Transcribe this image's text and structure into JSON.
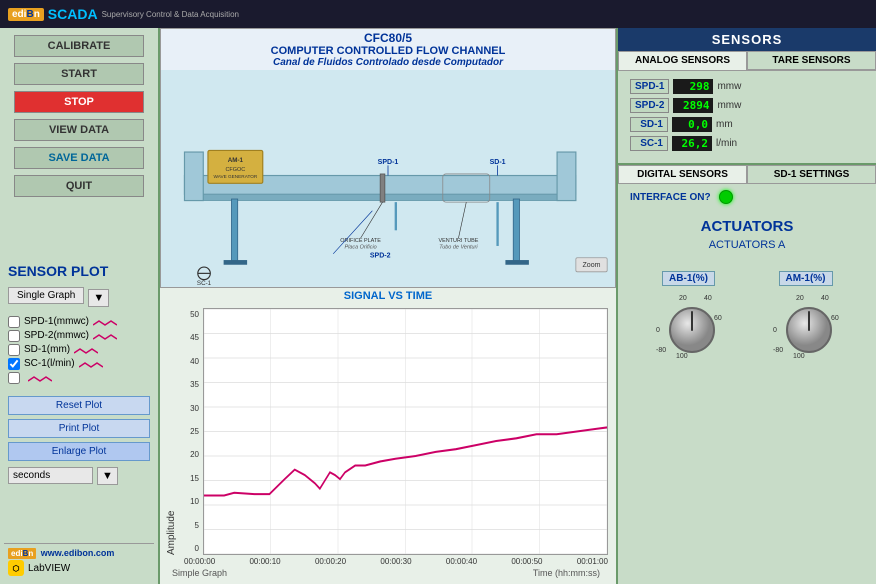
{
  "topbar": {
    "logo": "ediBon",
    "scada": "SCADA",
    "subtitle": "Supervisory Control & Data Acquisition"
  },
  "leftPanel": {
    "buttons": {
      "calibrate": "CALIBRATE",
      "start": "START",
      "stop": "STOP",
      "viewData": "VIEW DATA",
      "saveData": "SAVE DATA",
      "quit": "QUIT"
    },
    "sensorPlot": "SENSOR PLOT"
  },
  "graphControls": {
    "singleGraph": "Single Graph",
    "legend": [
      {
        "id": "spd1",
        "label": "SPD-1(mmwc)",
        "checked": false,
        "color": "#cc0066"
      },
      {
        "id": "spd2",
        "label": "SPD-2(mmwc)",
        "checked": false,
        "color": "#cc0066"
      },
      {
        "id": "sd1",
        "label": "SD-1(mm)",
        "checked": false,
        "color": "#cc0066"
      },
      {
        "id": "sc1",
        "label": "SC-1(l/min)",
        "checked": true,
        "color": "#cc0066"
      },
      {
        "id": "extra",
        "label": "",
        "checked": false,
        "color": "#cc0066"
      }
    ],
    "buttons": {
      "resetPlot": "Reset Plot",
      "printPlot": "Print Plot",
      "enlargePlot": "Enlarge Plot"
    },
    "seconds": "seconds"
  },
  "diagram": {
    "title1": "CFC80/5",
    "title2": "COMPUTER CONTROLLED FLOW CHANNEL",
    "title3": "Canal de Fluidos Controlado desde Computador"
  },
  "signalVsTime": "SIGNAL VS TIME",
  "chart": {
    "yAxisLabel": "Amplitude",
    "yTicks": [
      "50",
      "45",
      "40",
      "35",
      "30",
      "25",
      "20",
      "15",
      "10",
      "5",
      "0"
    ],
    "xLabels": [
      "00:00:00",
      "00:00:10",
      "00:00:20",
      "00:00:30",
      "00:00:40",
      "00:00:50",
      "00:01:00"
    ],
    "footer": {
      "simpleGraph": "Simple Graph",
      "timeLabel": "Time (hh:mm:ss)"
    }
  },
  "sensors": {
    "header": "SENSORS",
    "tabs": {
      "analog": "ANALOG SENSORS",
      "tare": "TARE SENSORS"
    },
    "analogValues": [
      {
        "id": "SPD-1",
        "value": "298",
        "unit": "mmw"
      },
      {
        "id": "SPD-2",
        "value": "2894",
        "unit": "mmw"
      },
      {
        "id": "SD-1",
        "value": "0,0",
        "unit": "mm"
      },
      {
        "id": "SC-1",
        "value": "26,2",
        "unit": "l/min"
      }
    ],
    "digital": {
      "tabs": {
        "digital": "DIGITAL SENSORS",
        "sd1settings": "SD-1 SETTINGS"
      },
      "interfaceLabel": "INTERFACE ON?"
    }
  },
  "actuators": {
    "header": "ACTUATORS",
    "subHeader": "ACTUATORS A",
    "knobs": [
      {
        "id": "AB-1",
        "label": "AB-1(%)",
        "scaleLeft": "0",
        "scaleRight": "60",
        "scaleMid": "40",
        "scaleBottom": "20",
        "scaleMinus": "-80",
        "scale100": "100"
      },
      {
        "id": "AM-1",
        "label": "AM-1(%)",
        "scaleLeft": "0",
        "scaleRight": "60",
        "scaleMid": "40",
        "scaleBottom": "20",
        "scaleMinus": "-80",
        "scale100": "100"
      }
    ]
  },
  "bottomBar": {
    "website": "www.edibon.com",
    "labview": "LabVIEW"
  }
}
